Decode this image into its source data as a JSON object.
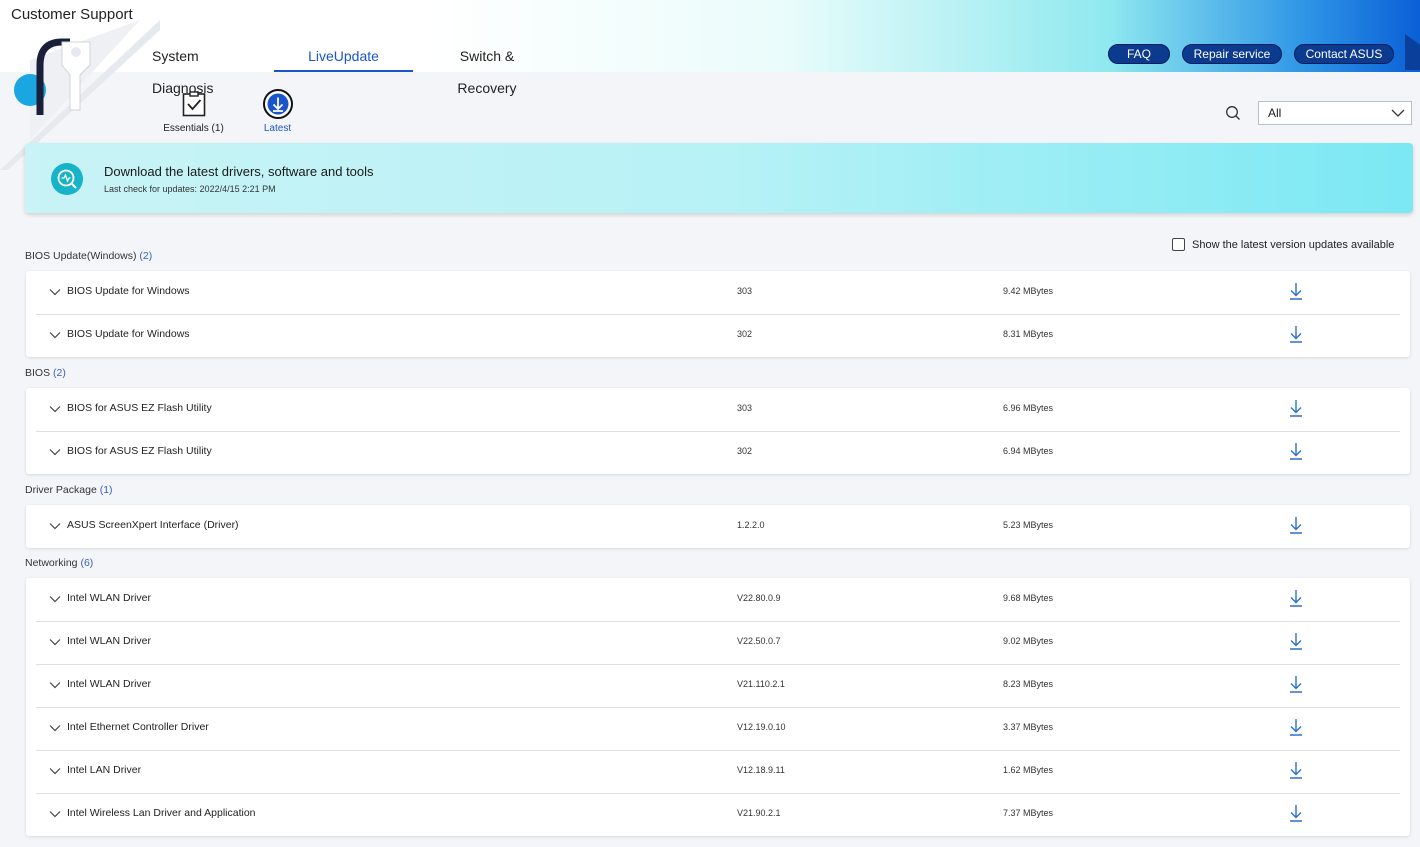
{
  "app": {
    "title": "Customer Support"
  },
  "tabs": [
    {
      "label": "System Diagnosis"
    },
    {
      "label": "LiveUpdate"
    },
    {
      "label": "Switch & Recovery"
    }
  ],
  "header_buttons": {
    "faq": "FAQ",
    "repair": "Repair service",
    "contact": "Contact ASUS"
  },
  "subtabs": [
    {
      "label": "Essentials (1)",
      "icon": "checklist-icon"
    },
    {
      "label": "Latest",
      "icon": "download-circle-icon"
    }
  ],
  "filter": {
    "selected": "All"
  },
  "banner": {
    "title": "Download the latest drivers, software and tools",
    "subtitle": "Last check for updates:   2022/4/15  2:21 PM"
  },
  "show_latest": {
    "label": "Show the latest version updates available",
    "checked": false
  },
  "groups": [
    {
      "name": "BIOS Update(Windows)",
      "count": "(2)",
      "items": [
        {
          "name": "BIOS Update for Windows",
          "version": "303",
          "size": "9.42 MBytes"
        },
        {
          "name": "BIOS Update for Windows",
          "version": "302",
          "size": "8.31 MBytes"
        }
      ]
    },
    {
      "name": "BIOS",
      "count": "(2)",
      "items": [
        {
          "name": "BIOS for ASUS EZ Flash Utility",
          "version": "303",
          "size": "6.96 MBytes"
        },
        {
          "name": "BIOS for ASUS EZ Flash Utility",
          "version": "302",
          "size": "6.94 MBytes"
        }
      ]
    },
    {
      "name": "Driver Package",
      "count": "(1)",
      "items": [
        {
          "name": "ASUS ScreenXpert Interface (Driver)",
          "version": "1.2.2.0",
          "size": "5.23 MBytes"
        }
      ]
    },
    {
      "name": "Networking",
      "count": "(6)",
      "items": [
        {
          "name": "Intel WLAN Driver",
          "version": "V22.80.0.9",
          "size": "9.68 MBytes"
        },
        {
          "name": "Intel WLAN Driver",
          "version": "V22.50.0.7",
          "size": "9.02 MBytes"
        },
        {
          "name": "Intel WLAN Driver",
          "version": "V21.110.2.1",
          "size": "8.23 MBytes"
        },
        {
          "name": "Intel Ethernet Controller Driver",
          "version": "V12.19.0.10",
          "size": "3.37 MBytes"
        },
        {
          "name": "Intel LAN Driver",
          "version": "V12.18.9.11",
          "size": "1.62 MBytes"
        },
        {
          "name": "Intel Wireless Lan Driver and Application",
          "version": "V21.90.2.1",
          "size": "7.37 MBytes"
        }
      ]
    }
  ],
  "colors": {
    "accent": "#1a55c9",
    "pill": "#0b3a8f",
    "download": "#2d6fd6"
  }
}
